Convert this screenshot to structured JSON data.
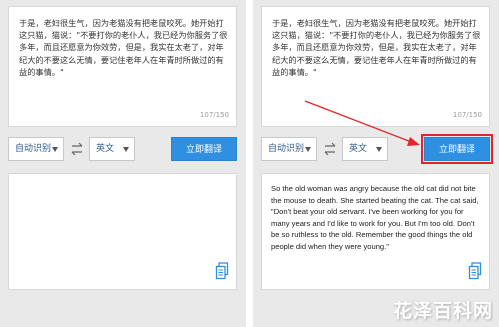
{
  "source": {
    "text": "于是，老妇很生气，因为老猫没有把老鼠咬死。她开始打这只猫，猫说：\"不要打你的老仆人，我已经为你服务了很多年，而且还愿意为你效劳，但是，我实在太老了，对年纪大的不要这么无情，要记住老年人在年青时所做过的有益的事情。\"",
    "counter": "107/150"
  },
  "controls": {
    "from_lang": "自动识别",
    "to_lang": "英文",
    "translate_label": "立即翻译"
  },
  "result": {
    "text": "So the old woman was angry because the old cat did not bite the mouse to death. She started beating the cat. The cat said, \"Don't beat your old servant. I've been working for you for many years and I'd like to work for you. But I'm too old. Don't be so ruthless to the old. Remember the good things the old people did when they were young.\""
  },
  "watermark": "花泽百科网",
  "colors": {
    "button": "#2f8fe0",
    "highlight": "#e0262a",
    "link_text": "#2c5a8c"
  }
}
